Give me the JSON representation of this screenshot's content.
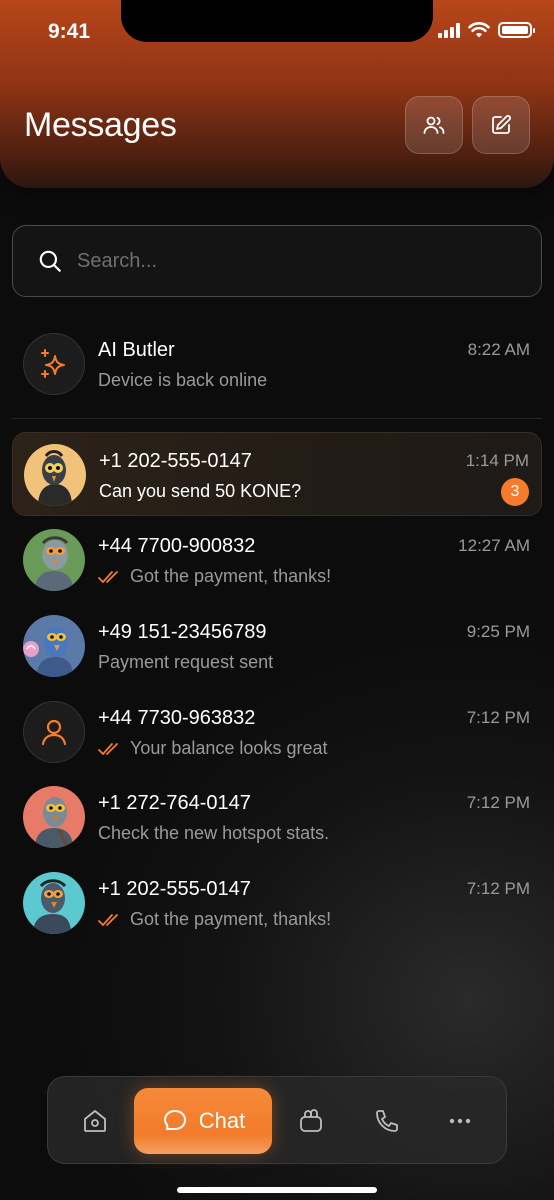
{
  "status_bar": {
    "time": "9:41"
  },
  "header": {
    "title": "Messages"
  },
  "search": {
    "placeholder": "Search..."
  },
  "colors": {
    "accent": "#f47c2c",
    "header": "#a03c17"
  },
  "chats": [
    {
      "name": "AI Butler",
      "preview": "Device is back online",
      "time": "8:22 AM",
      "avatar": "sparkle-icon"
    },
    {
      "name": "+1 202-555-0147",
      "preview": "Can you send 50 KONE?",
      "time": "1:14 PM",
      "unread": "3",
      "avatar": "pigeon-avatar-yellow"
    },
    {
      "name": "+44 7700-900832",
      "preview": "Got the payment, thanks!",
      "time": "12:27 AM",
      "read": true,
      "avatar": "pigeon-avatar-green"
    },
    {
      "name": "+49 151-23456789",
      "preview": "Payment request sent",
      "time": "9:25 PM",
      "avatar": "pigeon-avatar-blue"
    },
    {
      "name": "+44 7730-963832",
      "preview": "Your balance looks great",
      "time": "7:12 PM",
      "read": true,
      "avatar": "user-icon"
    },
    {
      "name": "+1 272-764-0147",
      "preview": "Check the new hotspot stats.",
      "time": "7:12 PM",
      "avatar": "pigeon-avatar-coral"
    },
    {
      "name": "+1 202-555-0147",
      "preview": "Got the payment, thanks!",
      "time": "7:12 PM",
      "read": true,
      "avatar": "pigeon-avatar-cyan"
    }
  ],
  "nav": {
    "chat_label": "Chat",
    "items": [
      "home-icon",
      "chat-icon",
      "wallet-icon",
      "phone-icon",
      "more-icon"
    ]
  }
}
